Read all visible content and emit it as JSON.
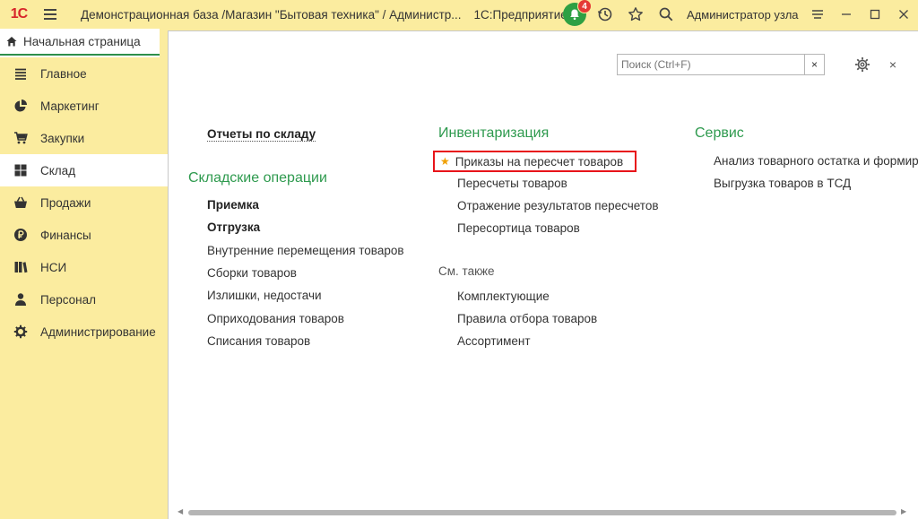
{
  "titlebar": {
    "logo": "1С",
    "title": "Демонстрационная база /Магазин \"Бытовая техника\" / Администр...",
    "app": "1С:Предприятие",
    "notifications_count": "4",
    "user": "Администратор узла"
  },
  "home_tab": {
    "label": "Начальная страница"
  },
  "sidebar": {
    "items": [
      {
        "label": "Главное",
        "icon": "list-icon"
      },
      {
        "label": "Маркетинг",
        "icon": "pie-chart-icon"
      },
      {
        "label": "Закупки",
        "icon": "cart-icon"
      },
      {
        "label": "Склад",
        "icon": "warehouse-grid-icon"
      },
      {
        "label": "Продажи",
        "icon": "basket-icon"
      },
      {
        "label": "Финансы",
        "icon": "ruble-coin-icon"
      },
      {
        "label": "НСИ",
        "icon": "books-icon"
      },
      {
        "label": "Персонал",
        "icon": "person-icon"
      },
      {
        "label": "Администрирование",
        "icon": "gear-icon"
      }
    ],
    "active": "Склад"
  },
  "search": {
    "placeholder": "Поиск (Ctrl+F)",
    "clear": "×"
  },
  "main": {
    "close": "×",
    "reports_link": "Отчеты по складу",
    "warehouse_ops": {
      "title": "Складские операции",
      "items": [
        "Приемка",
        "Отгрузка",
        "Внутренние перемещения товаров",
        "Сборки товаров",
        "Излишки, недостачи",
        "Оприходования товаров",
        "Списания товаров"
      ]
    },
    "inventory": {
      "title": "Инвентаризация",
      "items": [
        "Приказы на пересчет товаров",
        "Пересчеты товаров",
        "Отражение результатов пересчетов",
        "Пересортица товаров"
      ]
    },
    "see_also": {
      "title": "См. также",
      "items": [
        "Комплектующие",
        "Правила отбора товаров",
        "Ассортимент"
      ]
    },
    "service": {
      "title": "Сервис",
      "items": [
        "Анализ товарного остатка и формиро",
        "Выгрузка товаров в ТСД"
      ]
    }
  },
  "colors": {
    "panel": "#fbec9f",
    "group_title": "#2e9a4e",
    "highlight": "#e8141a",
    "notification": "#2ea043",
    "badge": "#e53935"
  }
}
